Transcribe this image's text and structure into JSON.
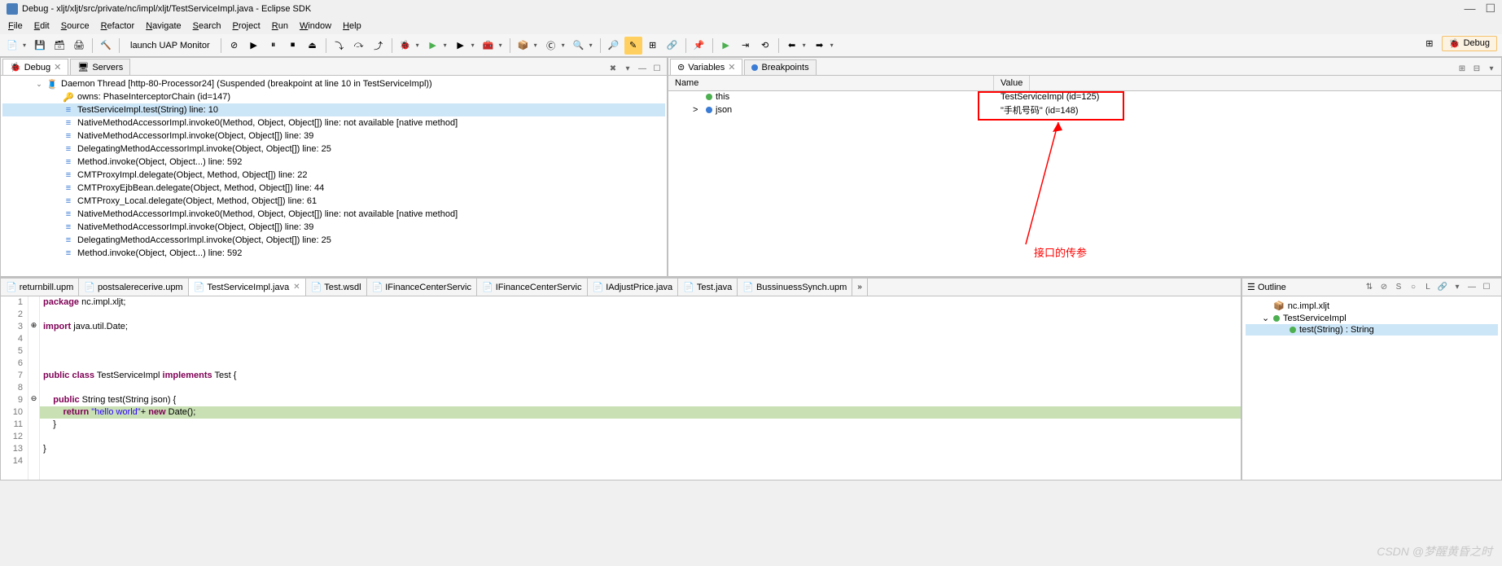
{
  "title": "Debug - xljt/xljt/src/private/nc/impl/xljt/TestServiceImpl.java - Eclipse SDK",
  "menu": [
    "File",
    "Edit",
    "Source",
    "Refactor",
    "Navigate",
    "Search",
    "Project",
    "Run",
    "Window",
    "Help"
  ],
  "toolbar_label": "launch UAP Monitor",
  "perspective_label": "Debug",
  "debug_tab": "Debug",
  "servers_tab": "Servers",
  "vars_tab": "Variables",
  "bp_tab": "Breakpoints",
  "outline_tab": "Outline",
  "vars_hdr_name": "Name",
  "vars_hdr_value": "Value",
  "debug_tree": [
    {
      "icon": "thread",
      "text": "Daemon Thread [http-80-Processor24] (Suspended (breakpoint at line 10 in TestServiceImpl))",
      "indent": 40,
      "tw": "⌄"
    },
    {
      "icon": "owns",
      "text": "owns: PhaseInterceptorChain  (id=147)",
      "indent": 60
    },
    {
      "icon": "stack",
      "text": "TestServiceImpl.test(String) line: 10",
      "indent": 60,
      "sel": true
    },
    {
      "icon": "stack",
      "text": "NativeMethodAccessorImpl.invoke0(Method, Object, Object[]) line: not available [native method]",
      "indent": 60
    },
    {
      "icon": "stack",
      "text": "NativeMethodAccessorImpl.invoke(Object, Object[]) line: 39",
      "indent": 60
    },
    {
      "icon": "stack",
      "text": "DelegatingMethodAccessorImpl.invoke(Object, Object[]) line: 25",
      "indent": 60
    },
    {
      "icon": "stack",
      "text": "Method.invoke(Object, Object...) line: 592",
      "indent": 60
    },
    {
      "icon": "stack",
      "text": "CMTProxyImpl.delegate(Object, Method, Object[]) line: 22",
      "indent": 60
    },
    {
      "icon": "stack",
      "text": "CMTProxyEjbBean.delegate(Object, Method, Object[]) line: 44",
      "indent": 60
    },
    {
      "icon": "stack",
      "text": "CMTProxy_Local.delegate(Object, Method, Object[]) line: 61",
      "indent": 60
    },
    {
      "icon": "stack",
      "text": "NativeMethodAccessorImpl.invoke0(Method, Object, Object[]) line: not available [native method]",
      "indent": 60
    },
    {
      "icon": "stack",
      "text": "NativeMethodAccessorImpl.invoke(Object, Object[]) line: 39",
      "indent": 60
    },
    {
      "icon": "stack",
      "text": "DelegatingMethodAccessorImpl.invoke(Object, Object[]) line: 25",
      "indent": 60
    },
    {
      "icon": "stack",
      "text": "Method.invoke(Object, Object...) line: 592",
      "indent": 60
    }
  ],
  "variables": [
    {
      "name": "this",
      "value": "TestServiceImpl  (id=125)",
      "icon": "green"
    },
    {
      "name": "json",
      "value": "\"手机号码\" (id=148)",
      "icon": "blue",
      "tw": ">"
    }
  ],
  "editor_tabs": [
    {
      "label": "returnbill.upm"
    },
    {
      "label": "postsalerecerive.upm"
    },
    {
      "label": "TestServiceImpl.java",
      "active": true
    },
    {
      "label": "Test.wsdl"
    },
    {
      "label": "IFinanceCenterServic"
    },
    {
      "label": "IFinanceCenterServic"
    },
    {
      "label": "IAdjustPrice.java"
    },
    {
      "label": "Test.java"
    },
    {
      "label": "BussinuessSynch.upm"
    }
  ],
  "code": {
    "lines": [
      {
        "n": "1",
        "html": "<span class='kw'>package</span> nc.impl.xljt;"
      },
      {
        "n": "2",
        "html": ""
      },
      {
        "n": "3",
        "html": "<span class='kw'>import</span> java.util.Date;",
        "marker": "⊕"
      },
      {
        "n": "4",
        "html": ""
      },
      {
        "n": "5",
        "html": ""
      },
      {
        "n": "6",
        "html": ""
      },
      {
        "n": "7",
        "html": "<span class='kw'>public</span> <span class='kw'>class</span> TestServiceImpl <span class='kw'>implements</span> Test {"
      },
      {
        "n": "8",
        "html": ""
      },
      {
        "n": "9",
        "html": "    <span class='kw'>public</span> String test(String json) {",
        "marker": "⊖"
      },
      {
        "n": "10",
        "html": "        <span class='kw'>return</span> <span class='str'>\"hello world\"</span>+ <span class='kw'>new</span> Date();",
        "bp": true
      },
      {
        "n": "11",
        "html": "    }"
      },
      {
        "n": "12",
        "html": ""
      },
      {
        "n": "13",
        "html": "}"
      },
      {
        "n": "14",
        "html": ""
      }
    ]
  },
  "outline": [
    {
      "icon": "pkg",
      "text": "nc.impl.xljt",
      "indent": 20
    },
    {
      "icon": "cls",
      "text": "TestServiceImpl",
      "indent": 20,
      "tw": "⌄"
    },
    {
      "icon": "mtd",
      "text": "test(String) : String",
      "indent": 40,
      "sel": true
    }
  ],
  "annotation": "接口的传参",
  "watermark": "CSDN @梦醒黄昏之时"
}
